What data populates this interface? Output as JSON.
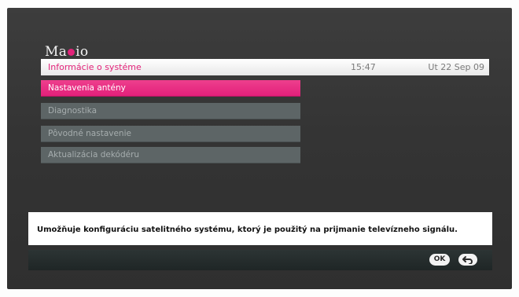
{
  "logo": {
    "text_left": "Ma",
    "text_right": "io",
    "dot_color": "#e3237a"
  },
  "header": {
    "title": "Informácie o systéme",
    "time": "15:47",
    "date": "Ut 22 Sep 09"
  },
  "menu": {
    "items": [
      {
        "label": "Nastavenia antény",
        "selected": true
      },
      {
        "label": "Diagnostika",
        "selected": false
      },
      {
        "label": "Pôvodné nastavenie",
        "selected": false
      },
      {
        "label": "Aktualizácia dekódéru",
        "selected": false
      }
    ]
  },
  "help": {
    "text": "Umožňuje konfiguráciu satelitného systému, ktorý je použitý na prijmanie televízneho signálu."
  },
  "footer": {
    "ok_label": "OK",
    "back_icon": "back-arrow-icon"
  },
  "colors": {
    "accent": "#e3237a",
    "menu_item": "#5d6566",
    "background": "#383838"
  }
}
